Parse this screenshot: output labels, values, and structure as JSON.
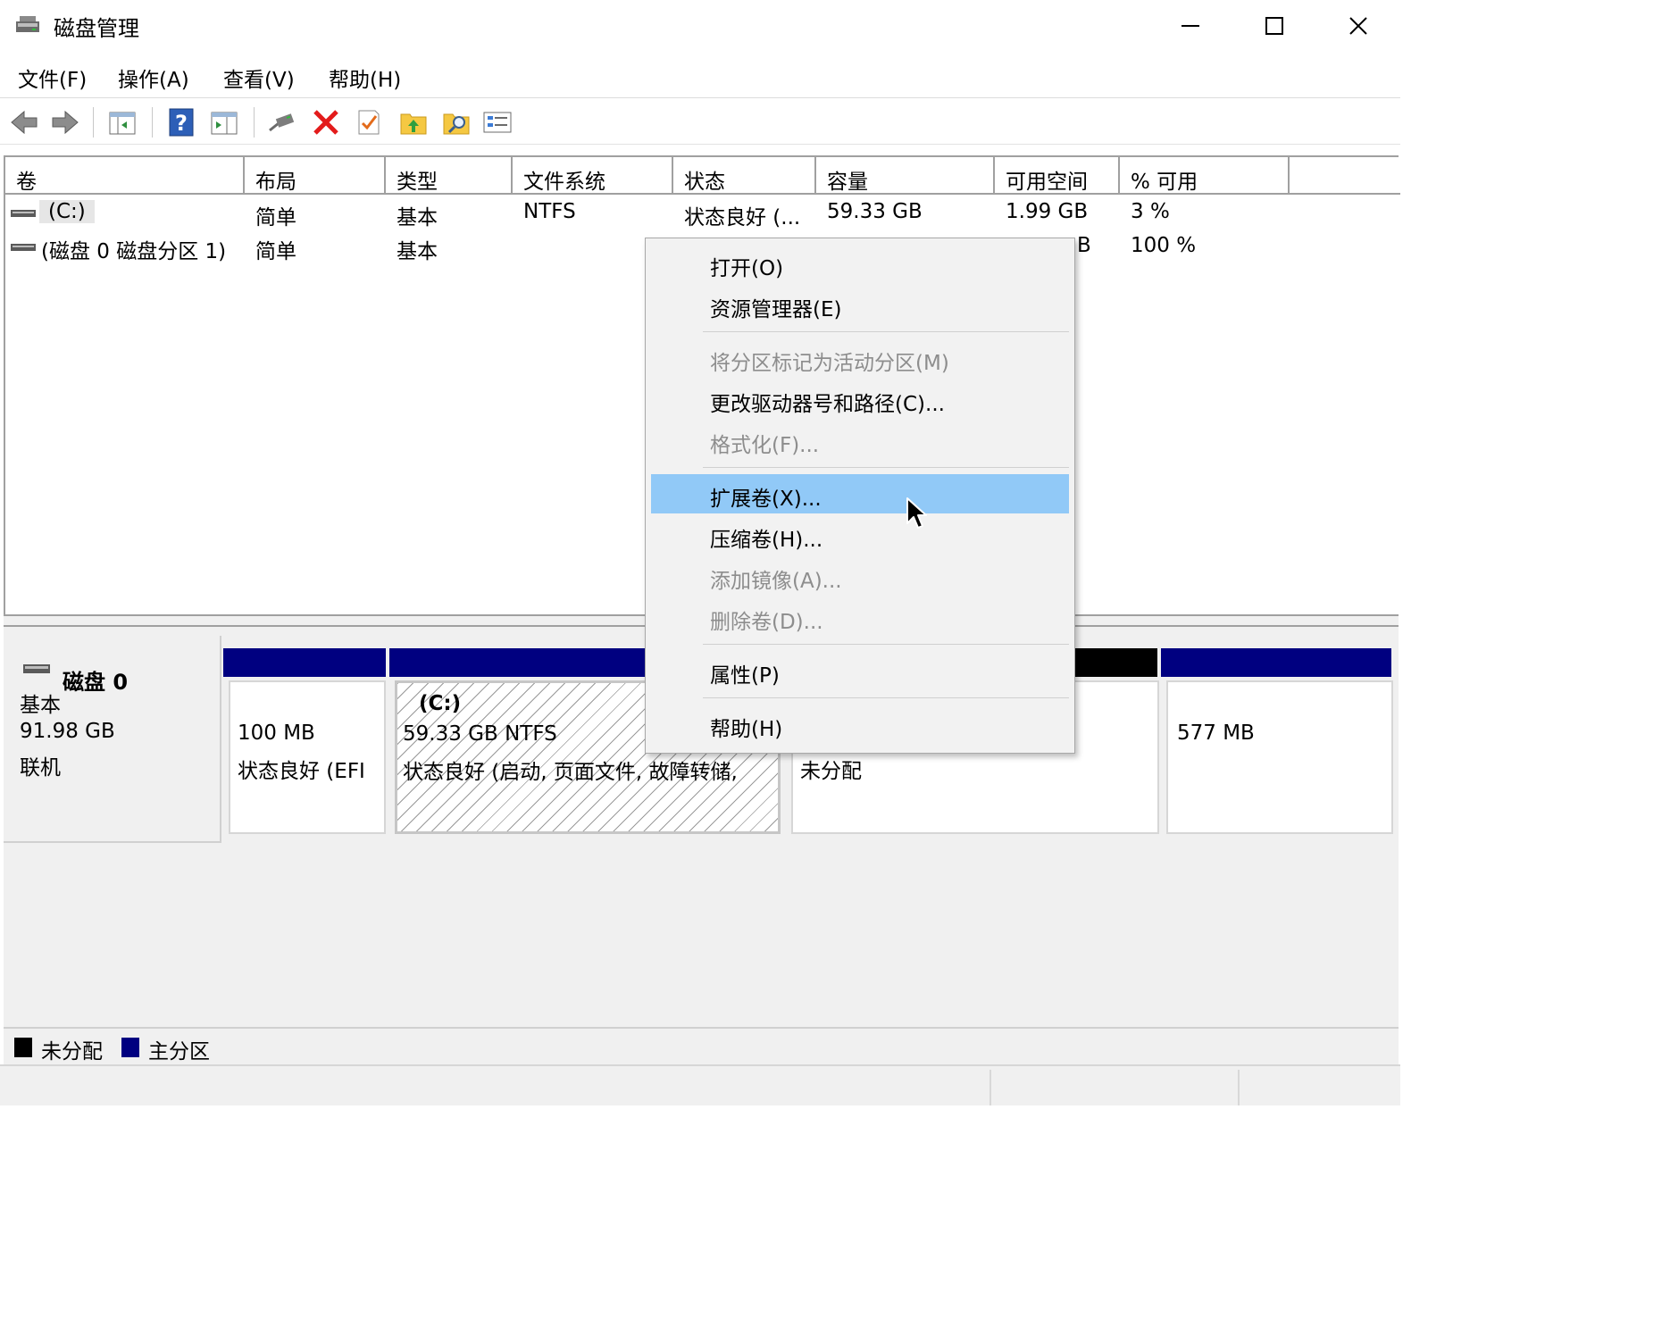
{
  "window": {
    "title": "磁盘管理",
    "minimize_glyph": "—",
    "maximize_glyph": "☐",
    "close_glyph": "✕"
  },
  "menu": [
    "文件(F)",
    "操作(A)",
    "查看(V)",
    "帮助(H)"
  ],
  "toolbar": {
    "icons": [
      "back-arrow-icon",
      "forward-arrow-icon",
      "console-tree-icon",
      "help-icon",
      "view-pane-icon",
      "connect-disk-icon",
      "delete-icon",
      "check-icon",
      "up-folder-icon",
      "search-folder-icon",
      "properties-list-icon"
    ]
  },
  "volume_table": {
    "columns": [
      "卷",
      "布局",
      "类型",
      "文件系统",
      "状态",
      "容量",
      "可用空间",
      "% 可用"
    ],
    "rows": [
      {
        "volume": "(C:)",
        "layout": "简单",
        "type": "基本",
        "fs": "NTFS",
        "status": "状态良好 (...",
        "capacity": "59.33 GB",
        "free": "1.99 GB",
        "pct": "3 %"
      },
      {
        "volume": "(磁盘 0 磁盘分区 1)",
        "layout": "简单",
        "type": "基本",
        "fs": "",
        "status": "",
        "capacity": "",
        "free": "B",
        "pct": "100 %"
      }
    ]
  },
  "disk": {
    "name": "磁盘 0",
    "type": "基本",
    "size": "91.98 GB",
    "state": "联机",
    "partitions": [
      {
        "size": "100 MB",
        "status": "状态良好 (EFI"
      },
      {
        "label": "(C:)",
        "size": "59.33 GB NTFS",
        "status": "状态良好 (启动, 页面文件, 故障转储,"
      },
      {
        "status": "未分配"
      },
      {
        "size": "577 MB"
      }
    ]
  },
  "legend": [
    {
      "label": "未分配",
      "color": "#000000"
    },
    {
      "label": "主分区",
      "color": "#000080"
    }
  ],
  "colors": {
    "primary_partition": "#000080",
    "unallocated": "#000000",
    "menu_highlight": "#91c9f7"
  },
  "context_menu": {
    "items": [
      {
        "label": "打开(O)",
        "enabled": true
      },
      {
        "label": "资源管理器(E)",
        "enabled": true
      },
      {
        "label": "将分区标记为活动分区(M)",
        "enabled": false
      },
      {
        "label": "更改驱动器号和路径(C)...",
        "enabled": true
      },
      {
        "label": "格式化(F)...",
        "enabled": false
      },
      {
        "label": "扩展卷(X)...",
        "enabled": true,
        "highlighted": true
      },
      {
        "label": "压缩卷(H)...",
        "enabled": true
      },
      {
        "label": "添加镜像(A)...",
        "enabled": false
      },
      {
        "label": "删除卷(D)...",
        "enabled": false
      },
      {
        "label": "属性(P)",
        "enabled": true
      },
      {
        "label": "帮助(H)",
        "enabled": true
      }
    ]
  }
}
